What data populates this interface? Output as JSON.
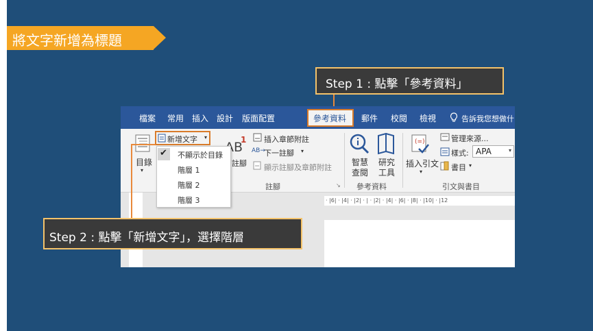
{
  "slide": {
    "title": "將文字新增為標題",
    "step1": "Step 1 : 點擊「參考資料」",
    "step2": "Step 2 : 點擊「新增文字」，選擇階層"
  },
  "ribbon_tabs": [
    {
      "label": "檔案"
    },
    {
      "label": "常用"
    },
    {
      "label": "插入"
    },
    {
      "label": "設計"
    },
    {
      "label": "版面配置"
    },
    {
      "label": "參考資料"
    },
    {
      "label": "郵件"
    },
    {
      "label": "校閱"
    },
    {
      "label": "檢視"
    }
  ],
  "tell_me": "告訴我您想做什",
  "ribbon": {
    "toc_label": "目錄",
    "add_text": "新增文字",
    "dropdown_items": [
      "不顯示於目錄",
      "階層 1",
      "階層 2",
      "階層 3"
    ],
    "insert_endnote": "插入章節附註",
    "next_footnote": "下一註腳",
    "show_notes": "顯示註腳及章節附註",
    "insert_footnote_partial": "註腳",
    "footnotes_group": "註腳",
    "smart_lookup": [
      "智慧",
      "查閱"
    ],
    "researcher": [
      "研究",
      "工具"
    ],
    "research_group": "參考資料",
    "insert_citation": "插入引文",
    "manage_sources": "管理來源...",
    "style_label": "樣式:",
    "style_value": "APA",
    "bibliography": "書目",
    "citations_group": "引文與書目"
  },
  "ruler_text": "· |6| · |4| · |2| · | · |2| · |4| · |6| · |8| · |10| · |12"
}
